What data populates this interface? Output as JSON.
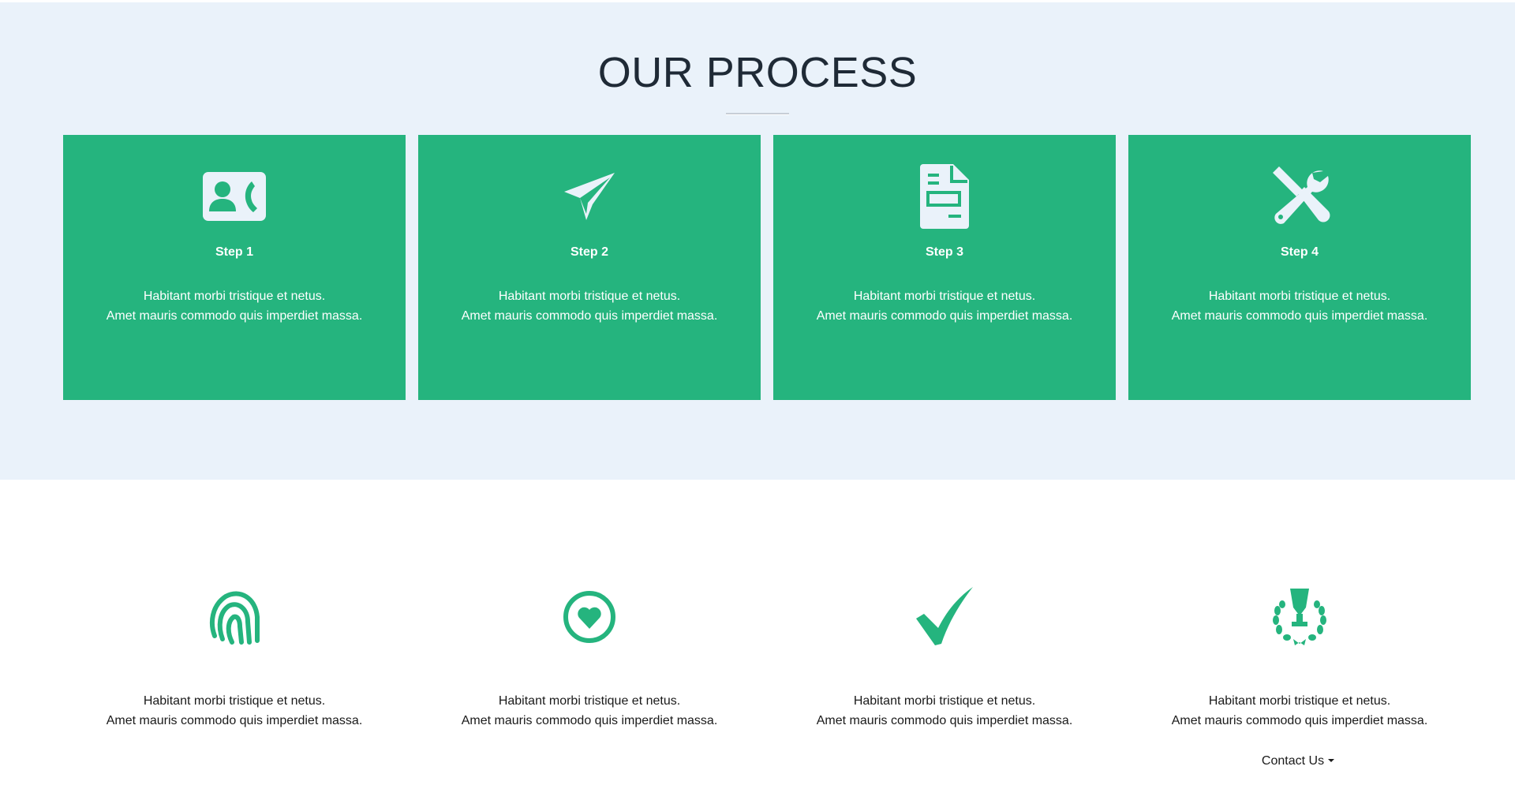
{
  "process": {
    "title": "OUR PROCESS",
    "steps": [
      {
        "icon": "contact-card-icon",
        "label": "Step 1",
        "line1": "Habitant morbi tristique et netus.",
        "line2": "Amet mauris commodo quis imperdiet massa."
      },
      {
        "icon": "paper-plane-icon",
        "label": "Step 2",
        "line1": "Habitant morbi tristique et netus.",
        "line2": "Amet mauris commodo quis imperdiet massa."
      },
      {
        "icon": "document-icon",
        "label": "Step 3",
        "line1": "Habitant morbi tristique et netus.",
        "line2": "Amet mauris commodo quis imperdiet massa."
      },
      {
        "icon": "tools-icon",
        "label": "Step 4",
        "line1": "Habitant morbi tristique et netus.",
        "line2": "Amet mauris commodo quis imperdiet massa."
      }
    ]
  },
  "features": [
    {
      "icon": "fingerprint-icon",
      "line1": "Habitant morbi tristique et netus.",
      "line2": "Amet mauris commodo quis imperdiet massa."
    },
    {
      "icon": "heart-circle-icon",
      "line1": "Habitant morbi tristique et netus.",
      "line2": "Amet mauris commodo quis imperdiet massa."
    },
    {
      "icon": "checkmark-icon",
      "line1": "Habitant morbi tristique et netus.",
      "line2": "Amet mauris commodo quis imperdiet massa."
    },
    {
      "icon": "trophy-laurel-icon",
      "line1": "Habitant morbi tristique et netus.",
      "line2": "Amet mauris commodo quis imperdiet massa."
    }
  ],
  "contact": {
    "label": "Contact Us"
  },
  "colors": {
    "accent": "#25b47e",
    "section_bg": "#eaf2fa",
    "icon_on_card": "#eaf2fa"
  }
}
